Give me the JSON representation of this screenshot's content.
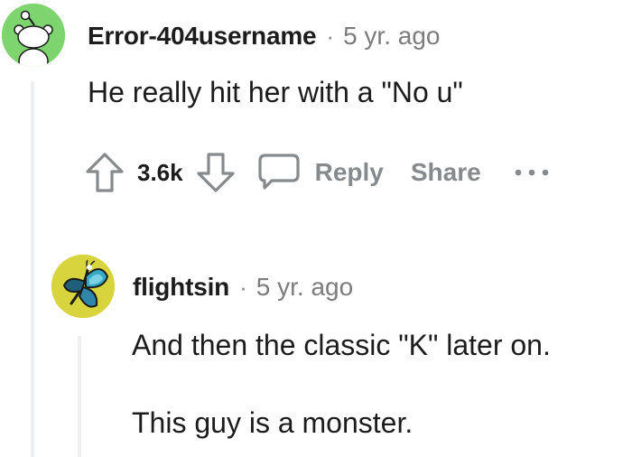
{
  "comment": {
    "author": "Error-404username",
    "separator": "·",
    "time": "5 yr. ago",
    "body": "He really hit her with a \"No u\"",
    "votes": "3.6k",
    "reply_label": "Reply",
    "share_label": "Share",
    "more_label": "•••",
    "avatar_color": "#7ed46e",
    "upvote_icon": "upvote-arrow-icon",
    "downvote_icon": "downvote-arrow-icon",
    "reply_icon": "speech-bubble-icon"
  },
  "reply": {
    "author": "flightsin",
    "separator": "·",
    "time": "5 yr. ago",
    "body_lines": [
      "And then the classic \"K\" later on.",
      "This guy is a monster."
    ],
    "avatar_color": "#d7d43d",
    "avatar_icon": "butterfly-icon"
  },
  "colors": {
    "text": "#1c1c1c",
    "meta": "#7c7c7c",
    "action": "#878a8c",
    "threadline": "#edeff1"
  }
}
